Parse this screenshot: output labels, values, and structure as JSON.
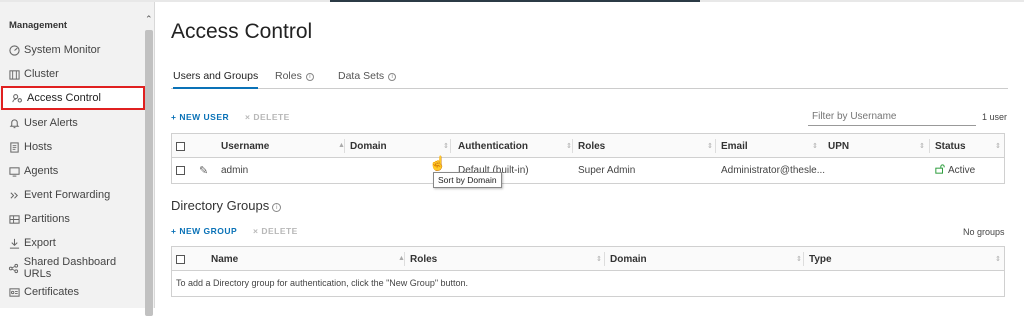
{
  "sidebar": {
    "section_title": "Management",
    "items": [
      {
        "label": "System Monitor",
        "icon": "gauge-icon"
      },
      {
        "label": "Cluster",
        "icon": "cluster-icon"
      },
      {
        "label": "Access Control",
        "icon": "users-key-icon",
        "active": true
      },
      {
        "label": "User Alerts",
        "icon": "bell-icon"
      },
      {
        "label": "Hosts",
        "icon": "document-icon"
      },
      {
        "label": "Agents",
        "icon": "monitor-icon"
      },
      {
        "label": "Event Forwarding",
        "icon": "double-chevron-icon"
      },
      {
        "label": "Partitions",
        "icon": "partitions-icon"
      },
      {
        "label": "Export",
        "icon": "download-icon"
      },
      {
        "label": "Shared Dashboard URLs",
        "icon": "share-icon"
      },
      {
        "label": "Certificates",
        "icon": "certificate-icon"
      }
    ]
  },
  "page": {
    "title": "Access Control",
    "tabs": [
      {
        "label": "Users and Groups",
        "active": true
      },
      {
        "label": "Roles"
      },
      {
        "label": "Data Sets"
      }
    ]
  },
  "users": {
    "new_label": "+ NEW USER",
    "delete_label": "× DELETE",
    "filter_placeholder": "Filter by Username",
    "count": "1 user",
    "columns": [
      "Username",
      "Domain",
      "Authentication",
      "Roles",
      "Email",
      "UPN",
      "Status"
    ],
    "rows": [
      {
        "username": "admin",
        "domain": "",
        "authentication": "Default (built-in)",
        "roles": "Super Admin",
        "email": "Administrator@thesle...",
        "upn": "",
        "status": "Active"
      }
    ],
    "tooltip": "Sort by Domain"
  },
  "groups": {
    "title": "Directory Groups",
    "new_label": "+ NEW GROUP",
    "delete_label": "× DELETE",
    "count": "No groups",
    "columns": [
      "Name",
      "Roles",
      "Domain",
      "Type"
    ],
    "empty_message": "To add a Directory group for authentication, click the \"New Group\" button."
  },
  "colors": {
    "accent": "#0a72b7",
    "active_outline": "#e02020",
    "status_active": "#2e9e3e"
  }
}
